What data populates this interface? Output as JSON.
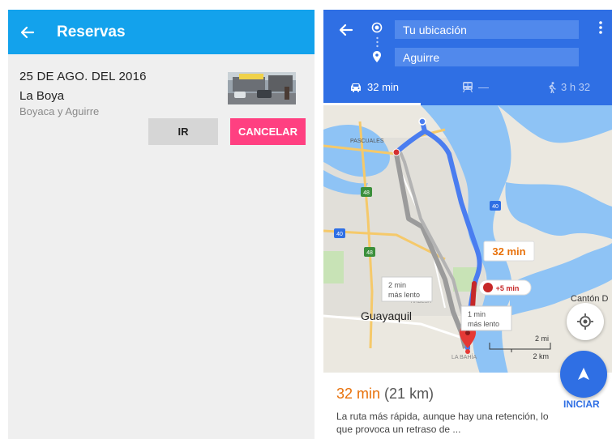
{
  "reservas": {
    "title": "Reservas",
    "card": {
      "date": "25 DE AGO. DEL 2016",
      "place": "La Boya",
      "address": "Boyaca y Aguirre",
      "ir_label": "IR",
      "cancel_label": "CANCELAR"
    }
  },
  "maps": {
    "origin": "Tu ubicación",
    "destination": "Aguirre",
    "modes": {
      "car": "32 min",
      "transit": "—",
      "walk": "3 h 32"
    },
    "map_labels": {
      "pascuales": "PASCUALES",
      "guayaquil": "Guayaquil",
      "canton": "Cantón D",
      "la_bahia": "LA BAHÍA",
      "ardesa": "ARDESA",
      "route_time": "32 min",
      "delay": "+5 min",
      "alt1_line1": "2 min",
      "alt1_line2": "más lento",
      "alt2_line1": "1 min",
      "alt2_line2": "más lento",
      "scale_mi": "2 mi",
      "scale_km": "2 km",
      "hw1": "48",
      "hw2": "40",
      "hw3": "40",
      "hw4": "48"
    },
    "summary": {
      "time": "32 min",
      "distance": "(21 km)",
      "description": "La ruta más rápida, aunque hay una retención, lo que provoca un retraso de ...",
      "start_label": "INICIAR"
    },
    "colors": {
      "primary": "#2f6fe4",
      "route": "#4a7df0",
      "alt_route": "#a6a6a6",
      "water": "#8ec3f5",
      "accent": "#e8710a"
    }
  }
}
